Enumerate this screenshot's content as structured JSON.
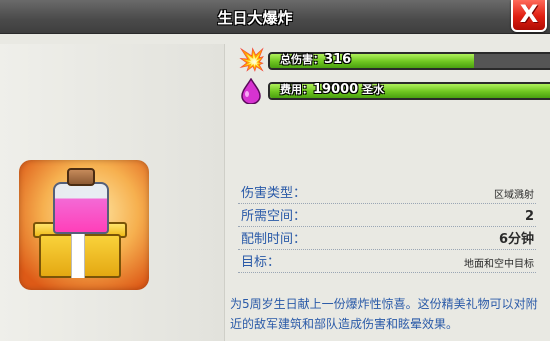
{
  "header": {
    "title": "生日大爆炸",
    "close_label": "X"
  },
  "stats": [
    {
      "icon": "explosion-icon",
      "label": "总伤害：",
      "value": "316",
      "unit": "",
      "fill": 0.72
    },
    {
      "icon": "elixir-drop-icon",
      "label": "费用：",
      "value": "19000",
      "unit": "圣水",
      "fill": 1.0
    }
  ],
  "info": [
    {
      "label": "伤害类型：",
      "value": "区域溅射"
    },
    {
      "label": "所需空间：",
      "value": "2"
    },
    {
      "label": "配制时间：",
      "value": "6分钟"
    },
    {
      "label": "目标：",
      "value": "地面和空中目标"
    }
  ],
  "description": "为5周岁生日献上一份爆炸性惊喜。这份精美礼物可以对附近的敌军建筑和部队造成伤害和眩晕效果。",
  "colors": {
    "bar_fill": "#6ec520",
    "close_button": "#e01f12",
    "label_blue": "#2a5aa8"
  }
}
